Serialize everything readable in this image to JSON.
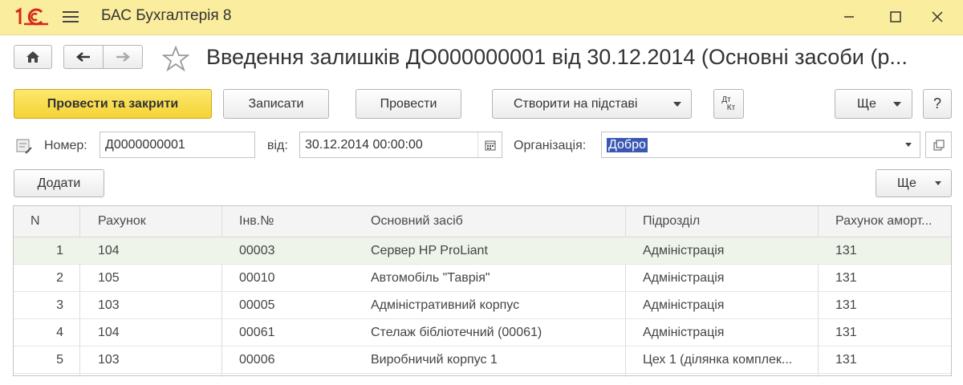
{
  "app": {
    "title": "БАС Бухгалтерія 8"
  },
  "document": {
    "title": "Введення залишків ДО000000001 від 30.12.2014 (Основні засоби (р..."
  },
  "toolbar": {
    "post_and_close": "Провести та закрити",
    "save": "Записати",
    "post": "Провести",
    "create_based_on": "Створити на підставі",
    "dt_kt_top": "Дт",
    "dt_kt_bottom": "Кт",
    "more": "Ще",
    "help": "?"
  },
  "header": {
    "number_label": "Номер:",
    "number_value": "Д0000000001",
    "date_label": "від:",
    "date_value": "30.12.2014 00:00:00",
    "org_label": "Організація:",
    "org_value": "Добро"
  },
  "table_toolbar": {
    "add": "Додати",
    "more": "Ще"
  },
  "table": {
    "columns": [
      "N",
      "Рахунок",
      "Інв.№",
      "Основний засіб",
      "Підрозділ",
      "Рахунок аморт..."
    ],
    "rows": [
      [
        "1",
        "104",
        "00003",
        "Сервер HP ProLiant",
        "Адміністрація",
        "131"
      ],
      [
        "2",
        "105",
        "00010",
        "Автомобіль \"Таврія\"",
        "Адміністрація",
        "131"
      ],
      [
        "3",
        "103",
        "00005",
        "Адміністративний корпус",
        "Адміністрація",
        "131"
      ],
      [
        "4",
        "104",
        "00061",
        "Стелаж  бібліотечний (00061)",
        "Адміністрація",
        "131"
      ],
      [
        "5",
        "103",
        "00006",
        "Виробничий корпус 1",
        "Цех 1 (ділянка комплек...",
        "131"
      ]
    ],
    "selected_row": 0
  },
  "icons": {
    "logo": "1c-logo-icon",
    "menu": "hamburger-icon",
    "home": "home-icon",
    "back": "arrow-left-icon",
    "forward": "arrow-right-icon",
    "favorite": "star-icon",
    "calendar": "calendar-icon",
    "dropdown": "chevron-down-icon",
    "open": "open-form-icon",
    "doc": "document-edit-icon"
  },
  "colors": {
    "titlebar": "#fbed9e",
    "primary_button": "#f5d335",
    "selection": "#3a57b3",
    "selected_row": "#eef4ea"
  }
}
